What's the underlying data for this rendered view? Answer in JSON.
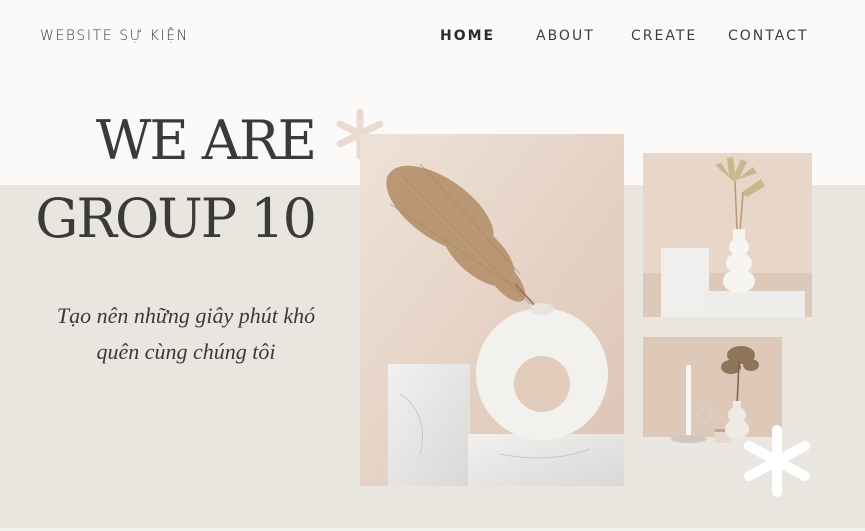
{
  "header": {
    "brand": "WEBSITE SỰ KIỆN",
    "nav": [
      {
        "label": "HOME",
        "active": true
      },
      {
        "label": "ABOUT",
        "active": false
      },
      {
        "label": "CREATE",
        "active": false
      },
      {
        "label": "CONTACT",
        "active": false
      }
    ]
  },
  "hero": {
    "title_line1": "WE ARE",
    "title_line2": "GROUP 10",
    "tagline": "Tạo nên những giây phút khó quên cùng chúng tôi"
  },
  "gallery": {
    "images": [
      {
        "icon": "vase-with-pampas-photo"
      },
      {
        "icon": "vase-with-palm-leaves-photo"
      },
      {
        "icon": "candle-and-dried-flowers-photo"
      }
    ]
  },
  "colors": {
    "background_top": "#fbfaf8",
    "background_band": "#e9e6df",
    "text": "#3a3a38",
    "accent_asterisk_top": "#eadad2",
    "accent_asterisk_bottom": "#ffffff"
  }
}
